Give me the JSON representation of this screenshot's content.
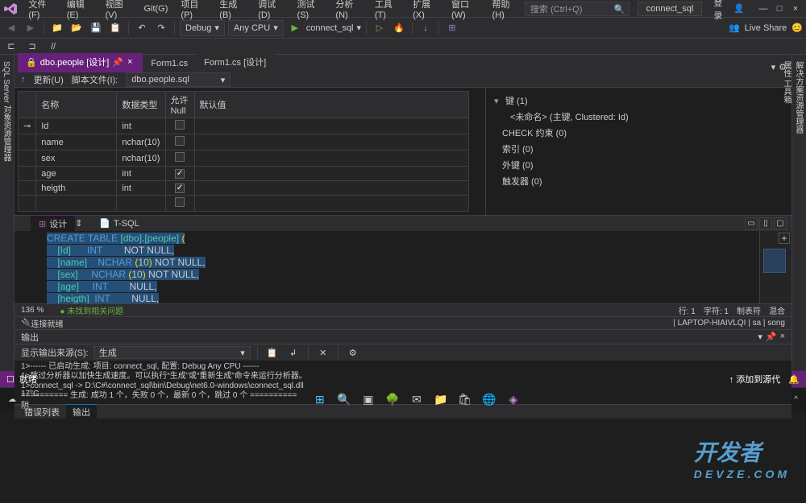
{
  "menu": {
    "items": [
      "文件(F)",
      "编辑(E)",
      "视图(V)",
      "Git(G)",
      "项目(P)",
      "生成(B)",
      "调试(D)",
      "测试(S)",
      "分析(N)",
      "工具(T)",
      "扩展(X)",
      "窗口(W)",
      "帮助(H)"
    ],
    "search_placeholder": "搜索 (Ctrl+Q)",
    "connect_label": "connect_sql",
    "login": "登录",
    "win": {
      "min": "—",
      "max": "□",
      "close": "×"
    }
  },
  "toolbar": {
    "config": "Debug",
    "platform": "Any CPU",
    "start": "connect_sql",
    "liveshare": "Live Share"
  },
  "tabs": {
    "items": [
      {
        "label": "dbo.people [设计]",
        "active": true
      },
      {
        "label": "Form1.cs",
        "active": false
      },
      {
        "label": "Form1.cs [设计]",
        "active": false
      }
    ]
  },
  "subbar": {
    "update": "更新(U)",
    "script_label": "脚本文件(I):",
    "script_value": "dbo.people.sql"
  },
  "design_table": {
    "headers": {
      "name": "名称",
      "type": "数据类型",
      "null": "允许 Null",
      "default": "默认值"
    },
    "rows": [
      {
        "key": "🔑",
        "name": "Id",
        "type": "int",
        "null": false
      },
      {
        "key": "",
        "name": "name",
        "type": "nchar(10)",
        "null": false
      },
      {
        "key": "",
        "name": "sex",
        "type": "nchar(10)",
        "null": false
      },
      {
        "key": "",
        "name": "age",
        "type": "int",
        "null": true
      },
      {
        "key": "",
        "name": "heigth",
        "type": "int",
        "null": true
      },
      {
        "key": "",
        "name": "",
        "type": "",
        "null": false
      }
    ]
  },
  "props": {
    "key_header": "键 (1)",
    "key_unnamed": "<未命名>  (主键, Clustered: Id)",
    "check": "CHECK 约束 (0)",
    "index": "索引 (0)",
    "fk": "外键 (0)",
    "trigger": "触发器 (0)"
  },
  "inner_tabs": {
    "design": "设计",
    "tsql": "T-SQL"
  },
  "sql": {
    "lines": [
      {
        "pre": "",
        "kw": "CREATE TABLE",
        "name": " [dbo].[people]",
        "rest": " ("
      },
      {
        "pre": "    ",
        "name": "[Id]",
        "pad": "      ",
        "type": "INT",
        "pad2": "         ",
        "rest": "NOT NULL,"
      },
      {
        "pre": "    ",
        "name": "[name]",
        "pad": "    ",
        "type": "NCHAR",
        "paren": " (",
        "num": "10",
        "paren2": ") ",
        "rest": "NOT NULL,"
      },
      {
        "pre": "    ",
        "name": "[sex]",
        "pad": "     ",
        "type": "NCHAR",
        "paren": " (",
        "num": "10",
        "paren2": ") ",
        "rest": "NOT NULL,"
      },
      {
        "pre": "    ",
        "name": "[age]",
        "pad": "     ",
        "type": "INT",
        "pad2": "         ",
        "rest": "NULL,"
      },
      {
        "pre": "    ",
        "name": "[heigth]",
        "pad": "  ",
        "type": "INT",
        "pad2": "         ",
        "rest": "NULL,"
      }
    ]
  },
  "sql_status": {
    "zoom": "136 %",
    "issues": "未找到相关问题",
    "line": "行: 1",
    "char": "字符: 1",
    "tab": "制表符",
    "mixed": "混合"
  },
  "conn_status": {
    "ready": "连接就绪",
    "server": "LAPTOP-HIAIVLQI",
    "user": "sa",
    "db": "song"
  },
  "output": {
    "title": "输出",
    "source_label": "显示输出来源(S):",
    "source_value": "生成",
    "lines": [
      "1>------ 已启动生成: 项目: connect_sql, 配置: Debug Any CPU ------",
      "1>跳过分析器以加快生成速度。可以执行“生成”或“重新生成”命令来运行分析器。",
      "1>connect_sql -> D:\\C#\\connect_sql\\bin\\Debug\\net6.0-windows\\connect_sql.dll",
      "========== 生成: 成功 1 个，失败 0 个，最新 0 个，跳过 0 个 =========="
    ]
  },
  "bottom_tabs": {
    "errors": "错误列表",
    "output": "输出"
  },
  "status": {
    "ready": "就绪",
    "add_source": "添加到源代"
  },
  "left_rail": "SQL Server 对象资源管理器",
  "right_rail_top": "解决方案资源管理器",
  "right_rail_bot": "属性 工具箱",
  "taskbar": {
    "temp": "17°C",
    "weather": "阴",
    "watermark": "开发者",
    "watermark_sub": "DEVZE.COM"
  }
}
